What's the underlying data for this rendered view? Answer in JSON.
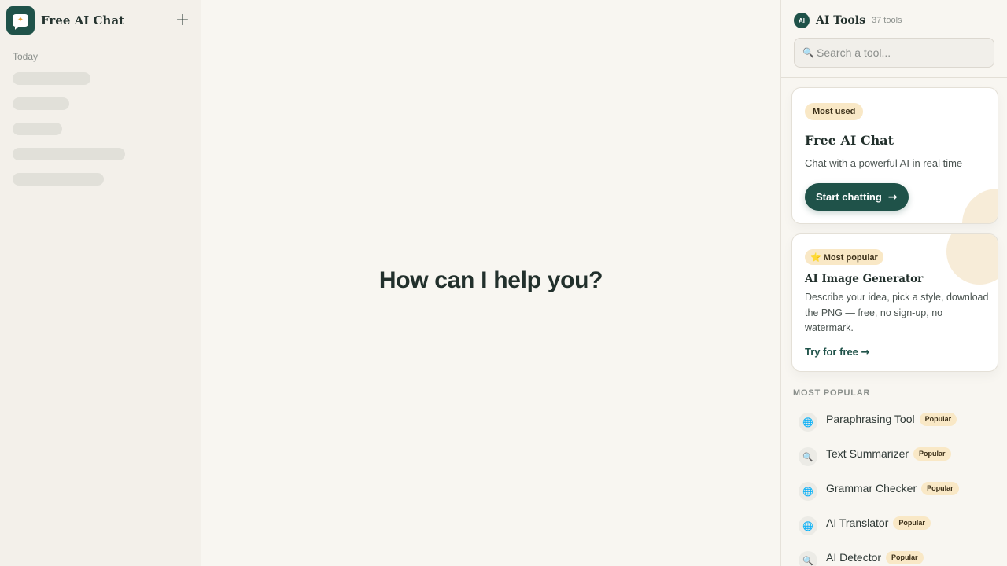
{
  "sidebar": {
    "brand_name": "Free AI Chat",
    "logo_icon": "chat-bubble-sparkle-icon",
    "new_chat_icon": "plus-icon",
    "new_chat_symbol": "+",
    "section_label": "Today"
  },
  "main": {
    "heading": "How can I help you?"
  },
  "panel": {
    "badge": "AI",
    "title": "AI Tools",
    "count": "37 tools",
    "search": {
      "placeholder": "Search a tool...",
      "icon": "🔍"
    },
    "featured_card": {
      "badge": "Most used",
      "title": "Free AI Chat",
      "description": "Chat with a powerful AI in real time",
      "cta_label": "Start chatting",
      "cta_arrow": "→"
    },
    "popular_card": {
      "badge": "⭐ Most popular",
      "title": "AI Image Generator",
      "description": "Describe your idea, pick a style, download the PNG — free, no sign-up, no watermark.",
      "link_label": "Try for free",
      "link_arrow": "→"
    },
    "section_label": "MOST POPULAR",
    "tools": [
      {
        "name": "Paraphrasing Tool",
        "badge": "Popular",
        "icon": "🌐"
      },
      {
        "name": "Text Summarizer",
        "badge": "Popular",
        "icon": "🔍"
      },
      {
        "name": "Grammar Checker",
        "badge": "Popular",
        "icon": "🌐"
      },
      {
        "name": "AI Translator",
        "badge": "Popular",
        "icon": "🌐"
      },
      {
        "name": "AI Detector",
        "badge": "Popular",
        "icon": "🔍"
      }
    ]
  },
  "colors": {
    "brand": "#1f5249",
    "badge_bg": "#f9e8c6",
    "background": "#f8f6f1",
    "sidebar_bg": "#f3f0ea"
  }
}
